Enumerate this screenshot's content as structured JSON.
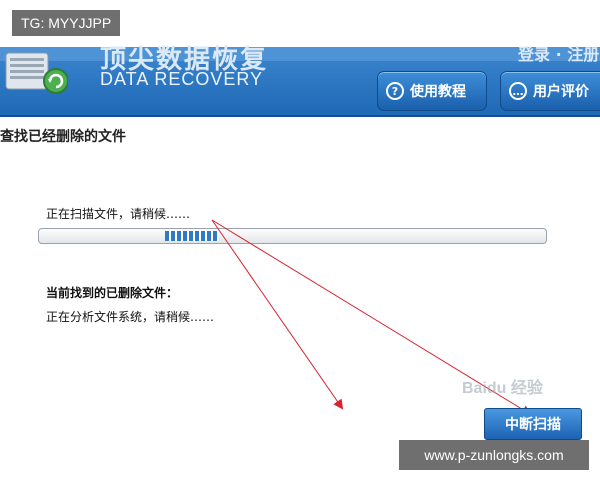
{
  "overlay": {
    "tg_label": "TG: MYYJJPP",
    "url_label": "www.p-zunlongks.com",
    "watermark_text": "Baidu 经验"
  },
  "header": {
    "title_cn": "顶尖数据恢复",
    "title_en": "DATA RECOVERY",
    "top_right_text": "登录 · 注册",
    "logo_icon": "disk-recovery-icon",
    "nav": [
      {
        "label": "使用教程",
        "icon": "help-icon"
      },
      {
        "label": "用户评价",
        "icon": "comment-icon"
      }
    ]
  },
  "main": {
    "section_title": "查找已经删除的文件",
    "scan_status": "正在扫描文件，请稍候……",
    "progress_state": "indeterminate",
    "found_label": "当前找到的已删除文件：",
    "analyze_status": "正在分析文件系统，请稍候……",
    "stop_button_label": "中断扫描"
  },
  "colors": {
    "banner": "#2b78c6",
    "button": "#1c63b3",
    "progress": "#2e79c8",
    "arrow": "#d9232e"
  }
}
